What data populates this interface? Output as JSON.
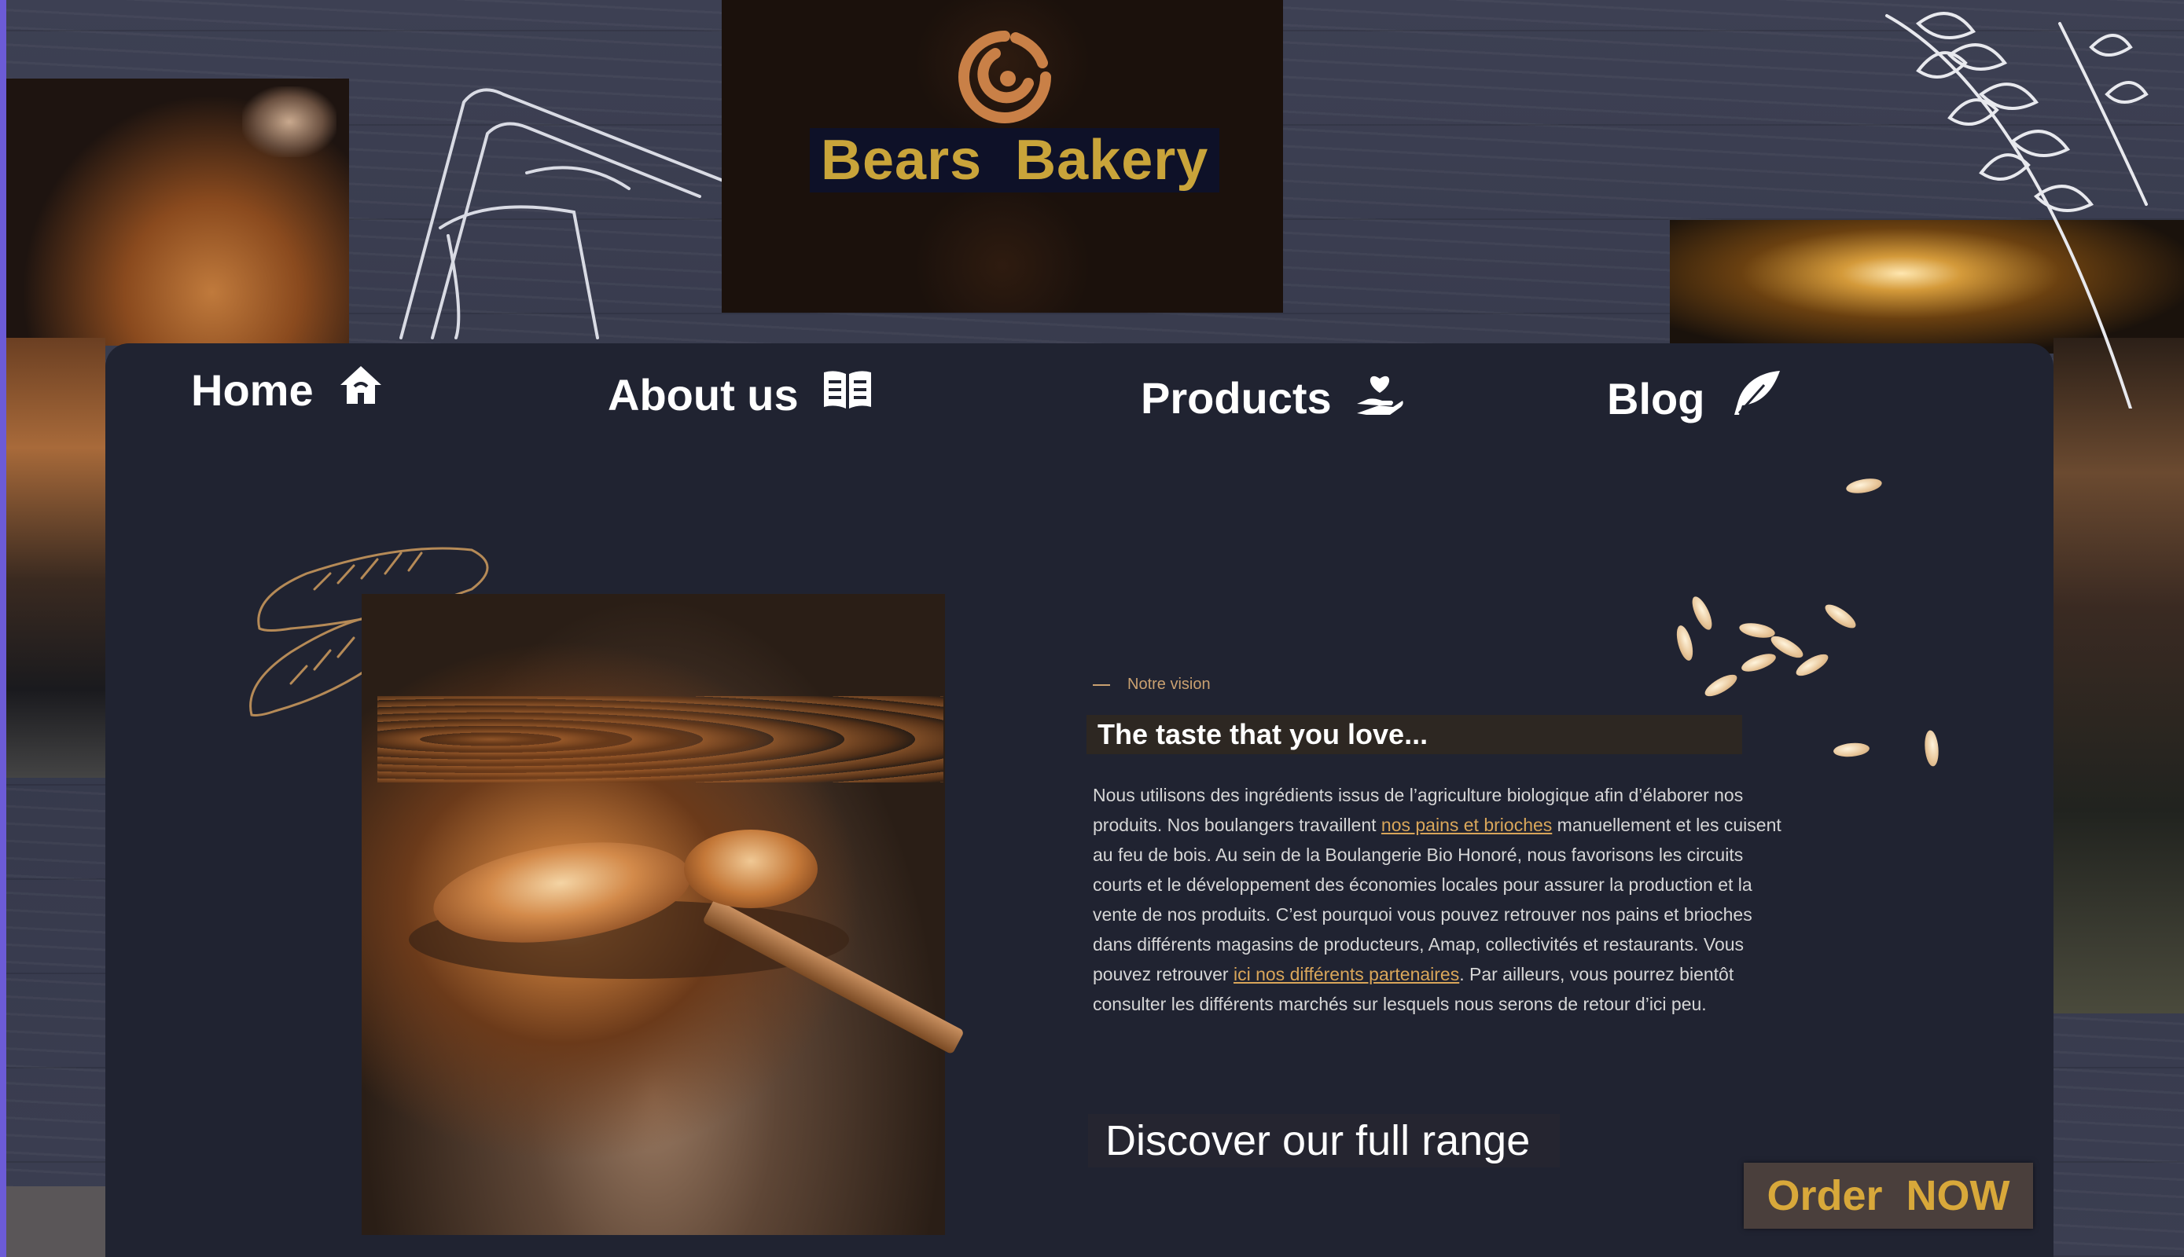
{
  "logo": {
    "title": "Bears  Bakery"
  },
  "nav": {
    "items": [
      {
        "label": "Home",
        "icon": "house-icon"
      },
      {
        "label": "About us",
        "icon": "open-book-icon"
      },
      {
        "label": "Products",
        "icon": "hand-heart-icon"
      },
      {
        "label": "Blog",
        "icon": "feather-icon"
      }
    ]
  },
  "vision": {
    "eyebrow": "Notre vision",
    "headline": "The taste that you love...",
    "paragraph": {
      "part1": "Nous utilisons des ingrédients issus de l’agriculture biologique afin d’élaborer nos produits. Nos boulangers travaillent ",
      "link1": "nos pains et brioches",
      "part2": " manuellement et les cuisent au feu de bois. Au sein de la Boulangerie Bio Honoré, nous favorisons les circuits courts et le développement des économies locales pour assurer la production et la vente de nos produits. C’est pourquoi vous pouvez retrouver nos pains et brioches dans différents magasins de producteurs, Amap, collectivités et restaurants. Vous pouvez retrouver ",
      "link2": "ici nos différents partenaires",
      "part3": ".  Par ailleurs, vous pourrez bientôt consulter les différents marchés sur lesquels nous serons de retour d’ici peu."
    }
  },
  "cta": {
    "discover": "Discover our full range",
    "order": "Order  NOW"
  },
  "colors": {
    "panel": "#202331",
    "gold": "#c9a43a",
    "link": "#d9a65a",
    "accent_border": "#6c5bd6"
  }
}
